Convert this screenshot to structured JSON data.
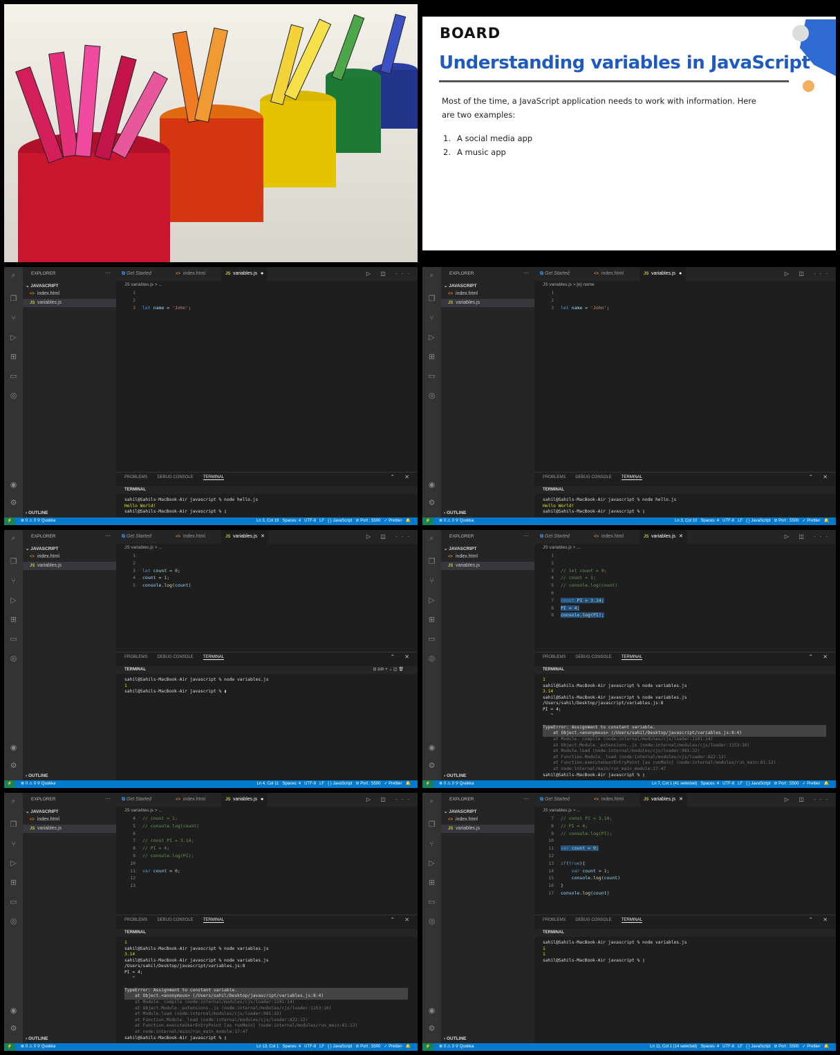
{
  "slide": {
    "logo": "BOARD",
    "title": "Understanding variables in JavaScript",
    "body": "Most of the time, a JavaScript application needs to work with information. Here are two examples:",
    "list": [
      {
        "n": "1.",
        "text": "A social media app"
      },
      {
        "n": "2.",
        "text": "A music app"
      }
    ],
    "colors": {
      "title": "#1f5bbf",
      "accent_blue": "#2e6bd3",
      "accent_orange": "#f0b060"
    }
  },
  "common": {
    "explorer": "EXPLORER",
    "folder": "JAVASCRIPT",
    "files": [
      "index.html",
      "variables.js"
    ],
    "file_icons": [
      "<>",
      "JS"
    ],
    "outline": "OUTLINE",
    "tab_get_started": "Get Started",
    "tab_index": "index.html",
    "tab_vars": "variables.js",
    "panel_tabs": [
      "PROBLEMS",
      "DEBUG CONSOLE",
      "TERMINAL"
    ],
    "terminal_label": "TERMINAL",
    "status_left": "⊗ 0 ⚠ 0    ⚲    Quokka",
    "status_items": "Spaces: 4   UTF-8   LF   { } JavaScript   ⊘ Port : 5500   ✓ Prettier"
  },
  "frames": [
    {
      "crumb": "JS variables.js > ...",
      "tab_dirty": "●",
      "status_pos": "Ln 3, Col 19",
      "code": [
        "",
        "",
        "let name = 'John';"
      ],
      "terminal": [
        "sahil@Sahils-MacBook-Air javascript % node hello.js",
        "Hello World!",
        "sahil@Sahils-MacBook-Air javascript % ▯"
      ]
    },
    {
      "crumb": "JS variables.js > [e] name",
      "tab_dirty": "●",
      "status_pos": "Ln 3, Col 10",
      "code": [
        "",
        "",
        "let name = 'John';"
      ],
      "terminal": [
        "sahil@Sahils-MacBook-Air javascript % node hello.js",
        "Hello World!",
        "sahil@Sahils-MacBook-Air javascript % ▯"
      ]
    },
    {
      "crumb": "JS variables.js > ...",
      "tab_dirty": "✕",
      "status_pos": "Ln 4, Col 11",
      "zsh": "⊡ zsh  +  ⌄  ◫  🗑",
      "code": [
        "",
        "",
        "let count = 0;",
        "count = 1;",
        "console.log(count)"
      ],
      "terminal": [
        "sahil@Sahils-MacBook-Air javascript % node variables.js",
        "1",
        "sahil@Sahils-MacBook-Air javascript % ▮"
      ]
    },
    {
      "crumb": "JS variables.js > ...",
      "tab_dirty": "✕",
      "status_pos": "Ln 7, Col 1 (41 selected)",
      "code": [
        "",
        "",
        "// let count = 0;",
        "// count = 1;",
        "// console.log(count)",
        "",
        "const PI = 3.14;",
        "PI = 4;",
        "console.log(PI);"
      ],
      "terminal": [
        "1",
        "sahil@Sahils-MacBook-Air javascript % node variables.js",
        "3.14",
        "sahil@Sahils-MacBook-Air javascript % node variables.js",
        "/Users/sahil/Desktop/javascript/variables.js:8",
        "PI = 4;",
        "   ^",
        "",
        "TypeError: Assignment to constant variable.",
        "    at Object.<anonymous> (/Users/sahil/Desktop/javascript/variables.js:8:4)",
        "    at Module._compile (node:internal/modules/cjs/loader:1101:14)",
        "    at Object.Module._extensions..js (node:internal/modules/cjs/loader:1153:10)",
        "    at Module.load (node:internal/modules/cjs/loader:981:32)",
        "    at Function.Module._load (node:internal/modules/cjs/loader:822:12)",
        "    at Function.executeUserEntryPoint [as runMain] (node:internal/modules/run_main:81:12)",
        "    at node:internal/main/run_main_module:17:47",
        "sahil@Sahils-MacBook-Air javascript % ▯"
      ]
    },
    {
      "crumb": "JS variables.js > ...",
      "tab_dirty": "●",
      "status_pos": "Ln 13, Col 1",
      "code_start": 4,
      "code": [
        "// count = 1;",
        "// console.log(count)",
        "",
        "// const PI = 3.14;",
        "// PI = 4;",
        "// console.log(PI);",
        "",
        "var count = 0;",
        "",
        ""
      ],
      "terminal": [
        "1",
        "sahil@Sahils-MacBook-Air javascript % node variables.js",
        "3.14",
        "sahil@Sahils-MacBook-Air javascript % node variables.js",
        "/Users/sahil/Desktop/javascript/variables.js:8",
        "PI = 4;",
        "   ^",
        "",
        "TypeError: Assignment to constant variable.",
        "    at Object.<anonymous> (/Users/sahil/Desktop/javascript/variables.js:8:4)",
        "    at Module._compile (node:internal/modules/cjs/loader:1101:14)",
        "    at Object.Module._extensions..js (node:internal/modules/cjs/loader:1153:10)",
        "    at Module.load (node:internal/modules/cjs/loader:981:32)",
        "    at Function.Module._load (node:internal/modules/cjs/loader:822:12)",
        "    at Function.executeUserEntryPoint [as runMain] (node:internal/modules/run_main:81:12)",
        "    at node:internal/main/run_main_module:17:47",
        "sahil@Sahils-MacBook-Air javascript % ▯"
      ]
    },
    {
      "crumb": "JS variables.js > ...",
      "tab_dirty": "✕",
      "status_pos": "Ln 11, Col 1 (14 selected)",
      "code_start": 7,
      "code": [
        "// const PI = 3.14;",
        "// PI = 4;",
        "// console.log(PI);",
        "",
        "var count = 0;",
        "",
        "if(true){",
        "    var count = 1;",
        "    console.log(count)",
        "}",
        "console.log(count)"
      ],
      "terminal": [
        "sahil@Sahils-MacBook-Air javascript % node variables.js",
        "1",
        "1",
        "sahil@Sahils-MacBook-Air javascript % ▯"
      ]
    }
  ]
}
